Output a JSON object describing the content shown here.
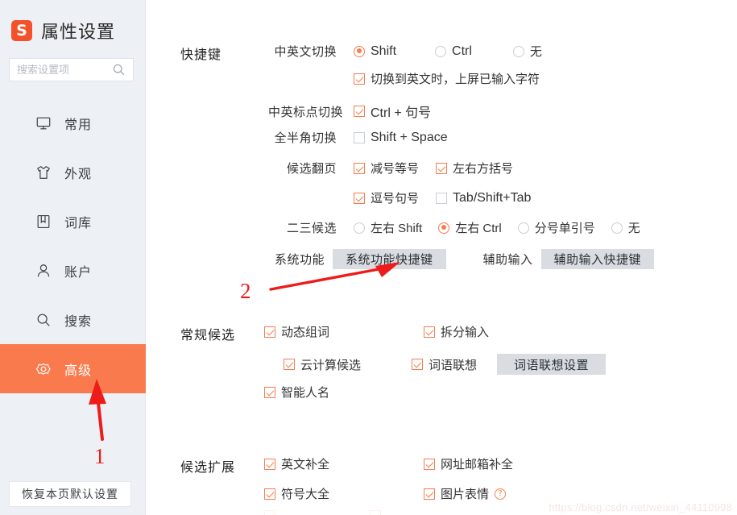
{
  "window": {
    "title": "属性设置",
    "logo_text": "S",
    "accent_color": "#f97b4d",
    "sidebar_bg": "#edf1f5",
    "controls": [
      {
        "name": "help",
        "glyph": "?"
      },
      {
        "name": "minimize",
        "glyph": "−"
      },
      {
        "name": "close",
        "glyph": "✕"
      }
    ]
  },
  "sidebar": {
    "search": {
      "value": "",
      "placeholder": "搜索设置项",
      "icon": "search-icon"
    },
    "items": [
      {
        "label": "常用",
        "icon": "monitor-icon",
        "active": false
      },
      {
        "label": "外观",
        "icon": "shirt-icon",
        "active": false
      },
      {
        "label": "词库",
        "icon": "book-icon",
        "active": false
      },
      {
        "label": "账户",
        "icon": "person-icon",
        "active": false
      },
      {
        "label": "搜索",
        "icon": "search-icon",
        "active": false
      },
      {
        "label": "高级",
        "icon": "gear-icon",
        "active": true
      }
    ],
    "reset_button": "恢复本页默认设置"
  },
  "sections": {
    "shortcut": {
      "title": "快捷键",
      "rows": {
        "cn_en_switch": {
          "label": "中英文切换",
          "options": [
            {
              "label": "Shift",
              "checked": true
            },
            {
              "label": "Ctrl",
              "checked": false
            },
            {
              "label": "无",
              "checked": false
            }
          ]
        },
        "commit_on_switch": {
          "label": "切换到英文时，上屏已输入字符",
          "checked": true
        },
        "punct_switch": {
          "label": "中英标点切换",
          "option": {
            "label": "Ctrl + 句号",
            "checked": true
          }
        },
        "width_switch": {
          "label": "全半角切换",
          "option": {
            "label": "Shift + Space",
            "checked": false
          }
        },
        "page_turn": {
          "label": "候选翻页",
          "options": [
            {
              "label": "减号等号",
              "checked": true
            },
            {
              "label": "左右方括号",
              "checked": true
            },
            {
              "label": "逗号句号",
              "checked": true
            },
            {
              "label": "Tab/Shift+Tab",
              "checked": false
            }
          ]
        },
        "second_third": {
          "label": "二三候选",
          "options": [
            {
              "label": "左右 Shift",
              "checked": false
            },
            {
              "label": "左右 Ctrl",
              "checked": true
            },
            {
              "label": "分号单引号",
              "checked": false
            },
            {
              "label": "无",
              "checked": false
            }
          ]
        },
        "system_function": {
          "label": "系统功能",
          "button": "系统功能快捷键",
          "label2": "辅助输入",
          "button2": "辅助输入快捷键"
        }
      }
    },
    "candidate": {
      "title": "常规候选",
      "items": [
        {
          "label": "动态组词",
          "checked": true
        },
        {
          "label": "拆分输入",
          "checked": true
        },
        {
          "label": "云计算候选",
          "checked": true
        },
        {
          "label": "词语联想",
          "checked": true
        },
        {
          "label": "智能人名",
          "checked": true
        }
      ],
      "button": "词语联想设置"
    },
    "extension": {
      "title": "候选扩展",
      "items": [
        {
          "label": "英文补全",
          "checked": true
        },
        {
          "label": "网址邮箱补全",
          "checked": true
        },
        {
          "label": "符号大全",
          "checked": true
        },
        {
          "label": "图片表情",
          "checked": true,
          "help": "?"
        }
      ]
    }
  },
  "annotations": [
    {
      "number": "1",
      "color": "#ee1b1b",
      "points_to": "sidebar-item-高级"
    },
    {
      "number": "2",
      "color": "#ee1b1b",
      "points_to": "system-function-shortcut-button"
    }
  ],
  "watermark": "https://blog.csdn.net/weixin_44110998"
}
